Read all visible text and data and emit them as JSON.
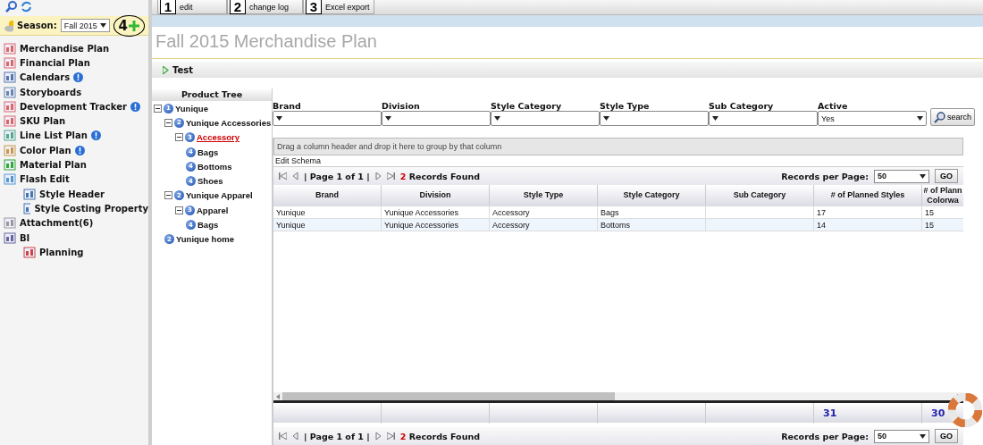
{
  "sidebar": {
    "season_label": "Season:",
    "season_value": "Fall 2015",
    "callout": "4",
    "items": [
      {
        "label": "Merchandise Plan",
        "alert": false
      },
      {
        "label": "Financial Plan",
        "alert": false
      },
      {
        "label": "Calendars",
        "alert": true
      },
      {
        "label": "Storyboards",
        "alert": false
      },
      {
        "label": "Development Tracker",
        "alert": true
      },
      {
        "label": "SKU Plan",
        "alert": false
      },
      {
        "label": "Line List Plan",
        "alert": true
      },
      {
        "label": "Color Plan",
        "alert": true
      },
      {
        "label": "Material Plan",
        "alert": false
      },
      {
        "label": "Flash Edit",
        "alert": false,
        "children": [
          {
            "label": "Style Header"
          },
          {
            "label": "Style Costing Property"
          }
        ]
      },
      {
        "label": "Attachment(6)",
        "alert": false
      },
      {
        "label": "BI",
        "alert": false,
        "children": [
          {
            "label": "Planning"
          }
        ]
      }
    ]
  },
  "toolbar": [
    {
      "callout": "1",
      "label": "edit"
    },
    {
      "callout": "2",
      "label": "change log"
    },
    {
      "callout": "3",
      "label": "Excel export"
    }
  ],
  "page_title": "Fall 2015 Merchandise Plan",
  "section": {
    "label": "Test",
    "expanded": false
  },
  "product_tree": {
    "title": "Product Tree",
    "nodes": [
      {
        "badge": "1",
        "label": "Yunique",
        "selected": false,
        "expanded": true,
        "children": [
          {
            "badge": "2",
            "label": "Yunique Accessories",
            "selected": false,
            "expanded": true,
            "children": [
              {
                "badge": "3",
                "label": "Accessory",
                "selected": true,
                "expanded": true,
                "children": [
                  {
                    "badge": "4",
                    "label": "Bags",
                    "selected": false
                  },
                  {
                    "badge": "4",
                    "label": "Bottoms",
                    "selected": false
                  },
                  {
                    "badge": "4",
                    "label": "Shoes",
                    "selected": false
                  }
                ]
              }
            ]
          },
          {
            "badge": "2",
            "label": "Yunique Apparel",
            "selected": false,
            "expanded": true,
            "children": [
              {
                "badge": "3",
                "label": "Apparel",
                "selected": false,
                "expanded": true,
                "children": [
                  {
                    "badge": "4",
                    "label": "Bags",
                    "selected": false
                  }
                ]
              }
            ]
          },
          {
            "badge": "2",
            "label": "Yunique home",
            "selected": false
          }
        ]
      }
    ]
  },
  "filters": [
    {
      "label": "Brand"
    },
    {
      "label": "Division"
    },
    {
      "label": "Style Category"
    },
    {
      "label": "Style Type"
    },
    {
      "label": "Sub Category"
    },
    {
      "label": "Active",
      "value": "Yes"
    }
  ],
  "search_button": "search",
  "grid": {
    "group_hint": "Drag a column header and drop it here to group by that column",
    "edit_schema": "Edit Schema",
    "pager": {
      "page": "| Page 1 of 1 |",
      "count": "2",
      "found": "Records Found",
      "per_page_label": "Records per Page:",
      "per_page": "50",
      "go": "GO"
    },
    "columns": [
      "Brand",
      "Division",
      "Style Type",
      "Style Category",
      "Sub Category",
      "# of Planned Styles",
      "# of Plann\nColorwa"
    ],
    "rows": [
      {
        "selected": false,
        "cells": [
          "Yunique",
          "Yunique Accessories",
          "Accessory",
          "Bags",
          null,
          "17",
          "15"
        ]
      },
      {
        "selected": false,
        "cells": [
          "Yunique",
          "Yunique Accessories",
          "Accessory",
          "Bottoms",
          null,
          "14",
          "15"
        ]
      }
    ],
    "totals": {
      "planned_styles": "31",
      "column_7": "30"
    },
    "bottom_pager": {
      "page": "| Page 1 of 1 |",
      "count": "2",
      "found": "Records Found",
      "per_page_label": "Records per Page:",
      "per_page": "50",
      "go": "GO"
    }
  }
}
